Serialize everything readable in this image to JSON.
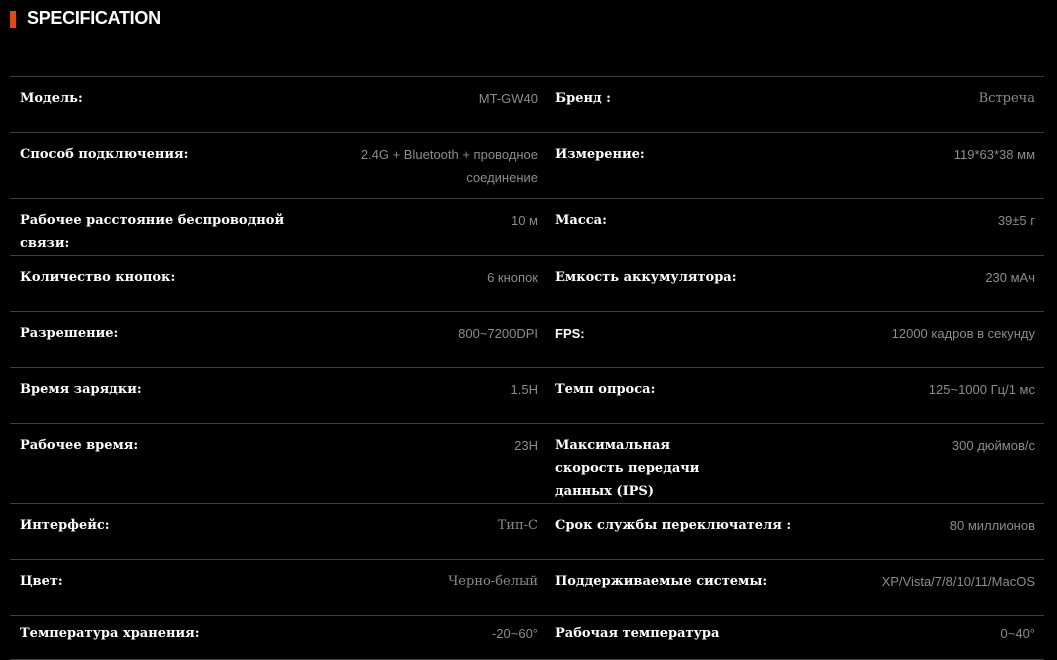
{
  "header": {
    "accent_color": "#e8460f",
    "title": "SPECIFICATION"
  },
  "specs": [
    {
      "label1": "Модель:",
      "value1": "MT-GW40",
      "label2": "Бренд :",
      "value2": "Встреча"
    },
    {
      "label1": "Способ подключения:",
      "value1": "2.4G + Bluetooth + проводное соединение",
      "label2": "Измерение:",
      "value2": "119*63*38 мм"
    },
    {
      "label1": "Рабочее расстояние беспроводной связи:",
      "value1": "10 м",
      "label2": "Масса:",
      "value2": "39±5 г"
    },
    {
      "label1": "Количество кнопок:",
      "value1": "6 кнопок",
      "label2": "Емкость аккумулятора:",
      "value2": "230 мАч"
    },
    {
      "label1": "Разрешение:",
      "value1": "800~7200DPI",
      "label2": "FPS:",
      "value2": "12000 кадров в секунду"
    },
    {
      "label1": "Время зарядки:",
      "value1": "1.5H",
      "label2": "Темп опроса:",
      "value2": "125~1000 Гц/1 мс"
    },
    {
      "label1": "Рабочее время:",
      "value1": "23H",
      "label2": "Максимальная скорость передачи данных (IPS)",
      "value2": "300 дюймов/с"
    },
    {
      "label1": "Интерфейс:",
      "value1": "Тип-C",
      "label2": "Срок службы переключателя :",
      "value2": "80 миллионов"
    },
    {
      "label1": "Цвет:",
      "value1": "Черно-белый",
      "label2": "Поддерживаемые системы:",
      "value2": "XP/Vista/7/8/10/11/MacOS"
    },
    {
      "label1": "Температура хранения:",
      "value1": "-20~60°",
      "label2": "Рабочая температура",
      "value2": "0~40°"
    }
  ]
}
